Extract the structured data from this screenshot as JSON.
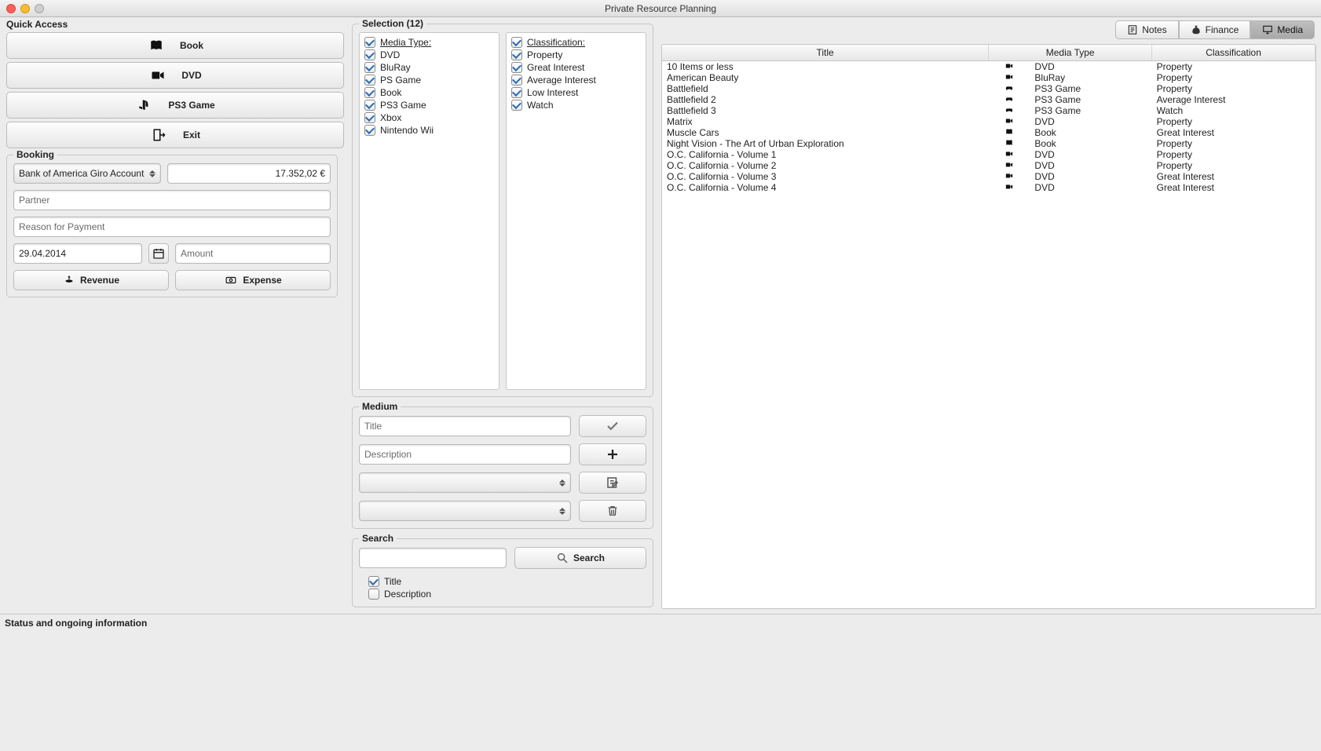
{
  "window": {
    "title": "Private Resource Planning"
  },
  "quick_access": {
    "title": "Quick Access",
    "buttons": {
      "book": "Book",
      "dvd": "DVD",
      "ps3": "PS3 Game",
      "exit": "Exit"
    }
  },
  "booking": {
    "title": "Booking",
    "account_selected": "Bank of America Giro Account",
    "balance": "17.352,02 €",
    "partner_placeholder": "Partner",
    "reason_placeholder": "Reason for Payment",
    "date_value": "29.04.2014",
    "amount_placeholder": "Amount",
    "revenue_label": "Revenue",
    "expense_label": "Expense"
  },
  "tabs": {
    "notes": "Notes",
    "finance": "Finance",
    "media": "Media"
  },
  "selection": {
    "title": "Selection (12)",
    "media_type_label": "Media Type:",
    "classification_label": "Classification:",
    "media_types": [
      "DVD",
      "BluRay",
      "PS Game",
      "Book",
      "PS3 Game",
      "Xbox",
      "Nintendo Wii"
    ],
    "classifications": [
      "Property",
      "Great Interest",
      "Average Interest",
      "Low Interest",
      "Watch"
    ]
  },
  "table": {
    "cols": {
      "title": "Title",
      "media_type": "Media Type",
      "classification": "Classification"
    },
    "rows": [
      {
        "title": "10 Items or less",
        "type": "DVD",
        "icon": "dvd",
        "class": "Property"
      },
      {
        "title": "American Beauty",
        "type": "BluRay",
        "icon": "dvd",
        "class": "Property"
      },
      {
        "title": "Battlefield",
        "type": "PS3 Game",
        "icon": "game",
        "class": "Property"
      },
      {
        "title": "Battlefield 2",
        "type": "PS3 Game",
        "icon": "game",
        "class": "Average Interest"
      },
      {
        "title": "Battlefield 3",
        "type": "PS3 Game",
        "icon": "game",
        "class": "Watch"
      },
      {
        "title": "Matrix",
        "type": "DVD",
        "icon": "dvd",
        "class": "Property"
      },
      {
        "title": "Muscle Cars",
        "type": "Book",
        "icon": "book",
        "class": "Great Interest"
      },
      {
        "title": "Night Vision - The Art of Urban Exploration",
        "type": "Book",
        "icon": "book",
        "class": "Property"
      },
      {
        "title": "O.C. California - Volume 1",
        "type": "DVD",
        "icon": "dvd",
        "class": "Property"
      },
      {
        "title": "O.C. California - Volume 2",
        "type": "DVD",
        "icon": "dvd",
        "class": "Property"
      },
      {
        "title": "O.C. California - Volume 3",
        "type": "DVD",
        "icon": "dvd",
        "class": "Great Interest"
      },
      {
        "title": "O.C. California - Volume 4",
        "type": "DVD",
        "icon": "dvd",
        "class": "Great Interest"
      }
    ]
  },
  "medium": {
    "title": "Medium",
    "title_placeholder": "Title",
    "desc_placeholder": "Description"
  },
  "search": {
    "title": "Search",
    "button": "Search",
    "chk_title": "Title",
    "chk_desc": "Description"
  },
  "status": "Status and ongoing information"
}
